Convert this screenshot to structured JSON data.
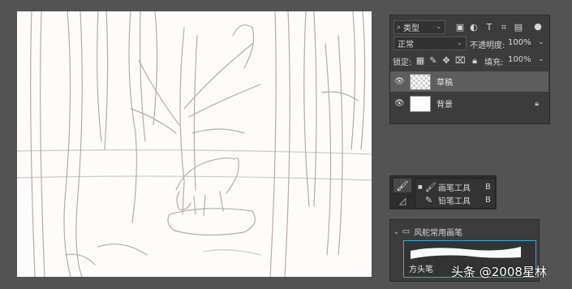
{
  "layers_panel": {
    "filter_label": "类型",
    "blend_mode": "正常",
    "opacity_label": "不透明度:",
    "opacity_value": "100%",
    "lock_label": "锁定:",
    "fill_label": "填充:",
    "fill_value": "100%",
    "layers": [
      {
        "name": "草稿",
        "thumbnail": "transparent",
        "visible": true,
        "selected": true,
        "locked": false
      },
      {
        "name": "背景",
        "thumbnail": "white",
        "visible": true,
        "selected": false,
        "locked": true
      }
    ]
  },
  "tool_flyout": {
    "items": [
      {
        "label": "画笔工具",
        "shortcut": "B",
        "icon": "brush-icon",
        "active": true
      },
      {
        "label": "铅笔工具",
        "shortcut": "B",
        "icon": "pencil-icon",
        "active": false
      }
    ]
  },
  "brushes_panel": {
    "group_name": "风舵常用画笔",
    "preset_name": "方头笔"
  },
  "watermark": "头条 @2008星林",
  "colors": {
    "workspace": "#535353",
    "panel": "#3c3c3c",
    "selection": "#5d5d5d",
    "accent": "#3aa8d8",
    "sketch": "#b9a9a4"
  }
}
